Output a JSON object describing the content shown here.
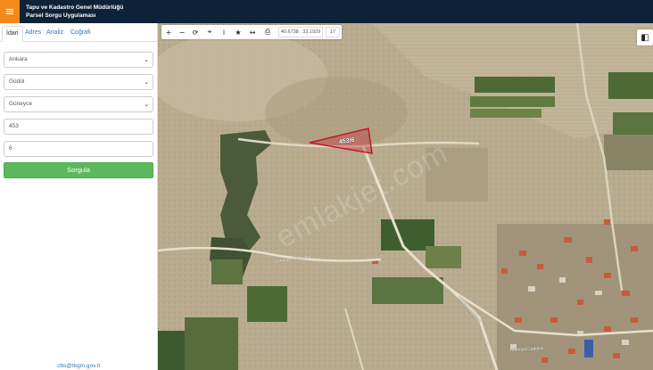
{
  "header": {
    "menu_icon": "≡",
    "title_line1": "Tapu ve Kadastro Genel Müdürlüğü",
    "title_line2": "Parsel Sorgu Uygulaması"
  },
  "sidebar": {
    "tabs": [
      "İdari",
      "Adres",
      "Analiz",
      "Coğrafi"
    ],
    "active_tab": "İdari",
    "il": "Ankara",
    "ilce": "Güdül",
    "mahalle": "Güneyce",
    "ada": "453",
    "parsel": "6",
    "submit_label": "Sorgula",
    "contact_email": "cbs@tkgm.gov.tr"
  },
  "map": {
    "toolbar": {
      "zoom_in": "+",
      "zoom_out": "−",
      "refresh": "⟳",
      "locate": "⌖",
      "info": "i",
      "favorite": "★",
      "measure": "↔",
      "print": "⎙",
      "coordinates": "40.6738 : 32.1929",
      "zoom_level": "17"
    },
    "layers_icon": "◧",
    "parcel_label": "453/6",
    "watermark": "emlakjet.com",
    "road_labels": [
      "Güneyce Mahallesi",
      "Mareşal Caddesi",
      "Mareşal Caddesi"
    ],
    "colors": {
      "parcel_stroke": "#c0182a",
      "parcel_fill": "rgba(200,30,45,0.35)",
      "header_bg": "#0d2137",
      "menu_btn": "#f28a1a",
      "submit": "#5cb85c"
    }
  }
}
